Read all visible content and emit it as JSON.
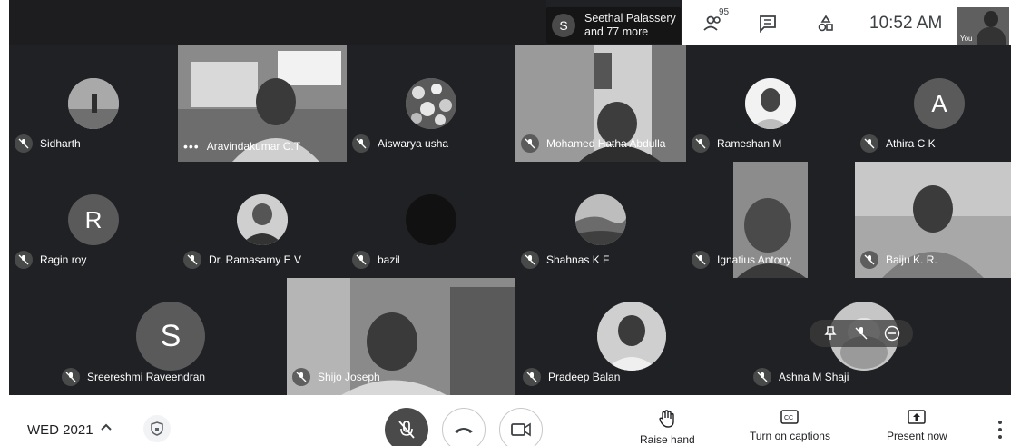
{
  "topbar": {
    "presenter_initial": "S",
    "presenter_name": "Seethal Palassery",
    "presenter_more": "and 77 more",
    "people_count": "95",
    "clock": "10:52 AM",
    "self_label": "You"
  },
  "participants": [
    {
      "name": "Sidharth",
      "muted": true,
      "avatar": "photo"
    },
    {
      "name": "Aravindakumar C.T",
      "muted": false,
      "avatar": "video"
    },
    {
      "name": "Aiswarya usha",
      "muted": true,
      "avatar": "photo"
    },
    {
      "name": "Mohamed Hatha Abdulla",
      "muted": true,
      "avatar": "video"
    },
    {
      "name": "Rameshan M",
      "muted": true,
      "avatar": "photo"
    },
    {
      "name": "Athira C K",
      "muted": true,
      "avatar": "letter",
      "initial": "A"
    },
    {
      "name": "Ragin roy",
      "muted": true,
      "avatar": "letter",
      "initial": "R"
    },
    {
      "name": "Dr. Ramasamy E V",
      "muted": true,
      "avatar": "photo"
    },
    {
      "name": "bazil",
      "muted": true,
      "avatar": "photo"
    },
    {
      "name": "Shahnas K F",
      "muted": true,
      "avatar": "photo"
    },
    {
      "name": "Ignatius Antony",
      "muted": true,
      "avatar": "video"
    },
    {
      "name": "Baiju K. R.",
      "muted": true,
      "avatar": "video"
    },
    {
      "name": "Sreereshmi Raveendran",
      "muted": true,
      "avatar": "letter",
      "initial": "S"
    },
    {
      "name": "Shijo Joseph",
      "muted": true,
      "avatar": "video"
    },
    {
      "name": "Pradeep Balan",
      "muted": true,
      "avatar": "photo"
    },
    {
      "name": "Ashna M Shaji",
      "muted": true,
      "avatar": "photo"
    }
  ],
  "bottombar": {
    "meeting_label": "WED 2021",
    "raise_hand": "Raise hand",
    "captions": "Turn on captions",
    "present": "Present now"
  },
  "icons": {
    "people": "people-icon",
    "chat": "chat-icon",
    "activities": "activities-icon",
    "mic": "mic-off-icon",
    "hangup": "hangup-icon",
    "camera": "camera-icon",
    "hand": "hand-icon",
    "cc": "captions-icon",
    "present": "present-icon",
    "more": "more-vert-icon"
  },
  "colors": {
    "grid_bg": "#202124",
    "bar_bg": "#ffffff",
    "text_dark": "#202124"
  }
}
